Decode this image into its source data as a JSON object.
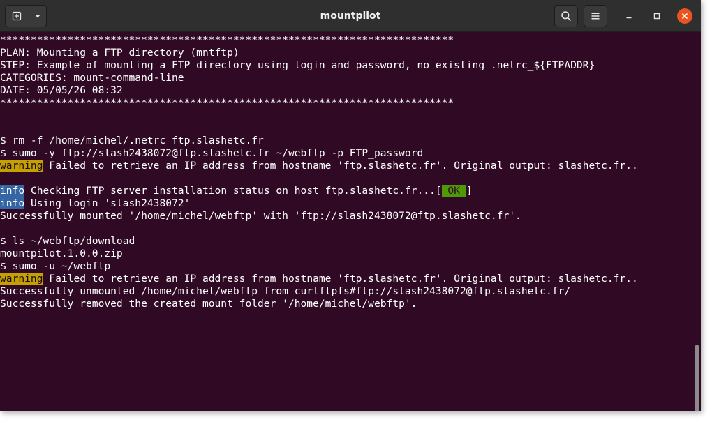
{
  "window": {
    "title": "mountpilot"
  },
  "icons": {
    "new_tab": "new-tab-icon",
    "dropdown": "chevron-down-icon",
    "search": "search-icon",
    "menu": "hamburger-menu-icon",
    "minimize": "minimize-icon",
    "maximize": "maximize-icon",
    "close": "close-icon"
  },
  "colors": {
    "terminal_bg": "#300a24",
    "titlebar_bg": "#2f2f2f",
    "warning_bg": "#c4a000",
    "info_bg": "#3465a4",
    "ok_bg": "#4e9a06",
    "close_btn": "#e95420"
  },
  "terminal": {
    "banner_top": "**************************************************************************",
    "plan": "PLAN: Mounting a FTP directory (mntftp)",
    "step": "STEP: Example of mounting a FTP directory using login and password, no existing .netrc_${FTPADDR}",
    "categories": "CATEGORIES: mount-command-line",
    "date": "DATE: 05/05/26 08:32",
    "banner_bottom": "**************************************************************************",
    "cmd_rm": "$ rm -f /home/michel/.netrc_ftp.slashetc.fr",
    "cmd_mount": "$ sumo -y ftp://slash2438072@ftp.slashetc.fr ~/webftp -p FTP_password",
    "warning1": {
      "tag": "warning",
      "text": " Failed to retrieve an IP address from hostname 'ftp.slashetc.fr'. Original output: slashetc.fr.."
    },
    "info1": {
      "tag": "info",
      "text": " Checking FTP server installation status on host ftp.slashetc.fr...[",
      "ok": " OK ",
      "end": "]"
    },
    "info2": {
      "tag": "info",
      "text": " Using login 'slash2438072'"
    },
    "mounted": "Successfully mounted '/home/michel/webftp' with 'ftp://slash2438072@ftp.slashetc.fr'.",
    "cmd_ls": "$ ls ~/webftp/download",
    "ls_output": "mountpilot.1.0.0.zip",
    "cmd_umount": "$ sumo -u ~/webftp",
    "warning2": {
      "tag": "warning",
      "text": " Failed to retrieve an IP address from hostname 'ftp.slashetc.fr'. Original output: slashetc.fr.."
    },
    "unmounted": "Successfully unmounted /home/michel/webftp from curlftpfs#ftp://slash2438072@ftp.slashetc.fr/",
    "removed": "Successfully removed the created mount folder '/home/michel/webftp'."
  }
}
